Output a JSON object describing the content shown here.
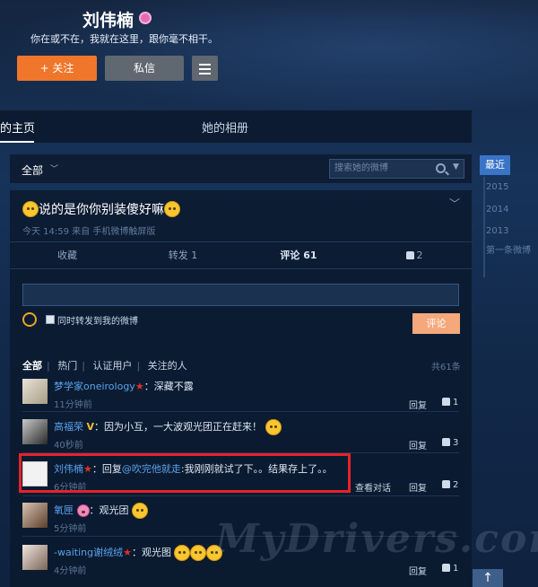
{
  "profile": {
    "name": "刘伟楠",
    "bio": "你在或不在，我就在这里，跟你毫不相干。",
    "follow_label": "+ 关注",
    "message_label": "私信"
  },
  "tabs": {
    "home": "的主页",
    "album": "她的相册"
  },
  "filter": {
    "all": "全部",
    "search_placeholder": "搜索她的微博"
  },
  "timeline": {
    "recent": "最近",
    "years": [
      "2015",
      "2014",
      "2013"
    ],
    "first": "第一条微博"
  },
  "post": {
    "text": "说的是你你别装傻好嘛",
    "meta": "今天 14:59 来自 手机微博触屏版",
    "actions": {
      "collect": "收藏",
      "repost": "转发 1",
      "comment": "评论 61",
      "like": "2"
    }
  },
  "composer": {
    "repost_label": "同时转发到我的微博",
    "submit_label": "评论"
  },
  "comment_filters": {
    "all": "全部",
    "hot": "热门",
    "verified": "认证用户",
    "following": "关注的人",
    "total": "共61条"
  },
  "comments": [
    {
      "name": "梦学家oneirology",
      "text": "：深藏不露",
      "time": "11分钟前",
      "reply": "回复",
      "likes": "1"
    },
    {
      "name": "高福荣",
      "text": "：因为小互，一大波观光团正在赶来！",
      "time": "40秒前",
      "reply": "回复",
      "likes": "3"
    },
    {
      "name": "刘伟楠",
      "prefix": "：回复",
      "mention": "@吹完他就走",
      "text": ":我刚刚就试了下。。结果存上了。。",
      "time": "6分钟前",
      "conversation": "查看对话",
      "reply": "回复",
      "likes": "2"
    },
    {
      "name": "氧匣",
      "text": "：观光团",
      "time": "5分钟前"
    },
    {
      "name": "-waiting谢绒绒",
      "text": "：观光图",
      "time": "4分钟前",
      "reply": "回复",
      "likes": "1"
    }
  ],
  "watermark": "MyDrivers.com",
  "up_arrow": "↑",
  "colors": {
    "accent": "#f0762b",
    "link": "#5aa2ec",
    "highlight": "#e6222a",
    "timeline_active": "#3a74c7"
  }
}
